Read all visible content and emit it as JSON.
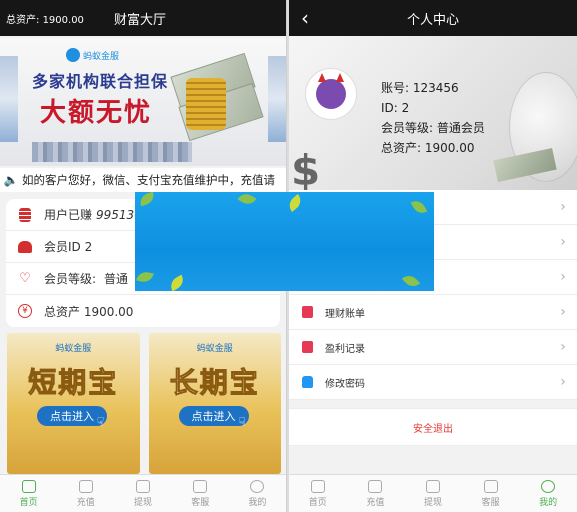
{
  "left": {
    "header": {
      "assets_label": "总资产:",
      "assets_value": "1900.00",
      "title": "财富大厅"
    },
    "banner": {
      "brand": "蚂蚁金服",
      "line1": "多家机构联合担保",
      "line2": "大额无忧"
    },
    "notice": {
      "icon": "speaker-icon",
      "text": "如的客户您好，微信、支付宝充值维护中，充值请"
    },
    "info_rows": [
      {
        "icon": "stack-icon",
        "label": "用户已赚",
        "value": "9951305"
      },
      {
        "icon": "users-icon",
        "label": "会员ID 2",
        "value": ""
      },
      {
        "icon": "heart-icon",
        "label": "会员等级:",
        "value": "普通"
      },
      {
        "icon": "coin-icon",
        "label": "总资产 1900.00",
        "value": ""
      }
    ],
    "cards": [
      {
        "brand": "蚂蚁金服",
        "title": "短期宝",
        "button": "点击进入"
      },
      {
        "brand": "蚂蚁金服",
        "title": "长期宝",
        "button": "点击进入"
      }
    ]
  },
  "right": {
    "header": {
      "back_icon": "back-chevron-icon",
      "title": "个人中心"
    },
    "profile": {
      "account_label": "账号:",
      "account": "123456",
      "id_label": "ID:",
      "id": "2",
      "level_label": "会员等级:",
      "level": "普通会员",
      "assets_label": "总资产:",
      "assets": "1900.00",
      "decor_dollar": "$"
    },
    "menu": [
      {
        "label": "",
        "color": "#d32f2f"
      },
      {
        "label": "",
        "color": "#d32f2f"
      },
      {
        "label": "",
        "color": "#d32f2f"
      },
      {
        "label": "理财账单",
        "color": "#e53955"
      },
      {
        "label": "盈利记录",
        "color": "#e53955"
      },
      {
        "label": "修改密码",
        "color": "#2196f3"
      }
    ],
    "logout": "安全退出"
  },
  "tabs": [
    "首页",
    "充值",
    "提现",
    "客服",
    "我的"
  ],
  "colors": {
    "accent_green": "#4caf50",
    "danger": "#e53935",
    "header_bg": "#161616",
    "popup_blue": "#0e8fe0"
  }
}
